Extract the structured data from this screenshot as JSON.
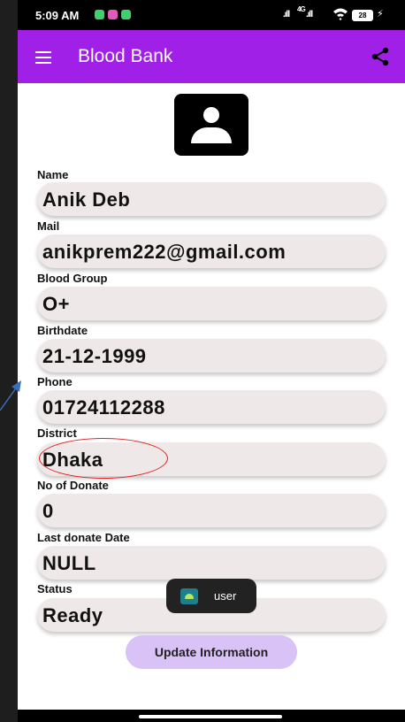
{
  "status_bar": {
    "time": "5:09 AM",
    "network": "4G",
    "battery": "28",
    "notification_colors": [
      "#3bd16f",
      "#e05ab9",
      "#3bd16f"
    ]
  },
  "app_bar": {
    "title": "Blood Bank",
    "background": "#a020e8",
    "menu_icon": "hamburger-menu-icon",
    "share_icon": "share-icon"
  },
  "profile": {
    "avatar_icon": "person-icon",
    "fields": [
      {
        "label": "Name",
        "value": "Anik Deb"
      },
      {
        "label": "Mail",
        "value": "anikprem222@gmail.com"
      },
      {
        "label": "Blood Group",
        "value": "O+"
      },
      {
        "label": "Birthdate",
        "value": "21-12-1999"
      },
      {
        "label": "Phone",
        "value": "01724112288"
      },
      {
        "label": "District",
        "value": "Dhaka"
      },
      {
        "label": "No of Donate",
        "value": "0"
      },
      {
        "label": "Last donate Date",
        "value": "NULL"
      },
      {
        "label": "Status",
        "value": "Ready"
      }
    ]
  },
  "update_button": {
    "label": "Update Information",
    "background": "#d9c2f5"
  },
  "toast": {
    "text": "user",
    "icon": "android-app-icon"
  },
  "annotations": {
    "circle_color": "#e02020",
    "arrow_color": "#3a6fb8"
  }
}
